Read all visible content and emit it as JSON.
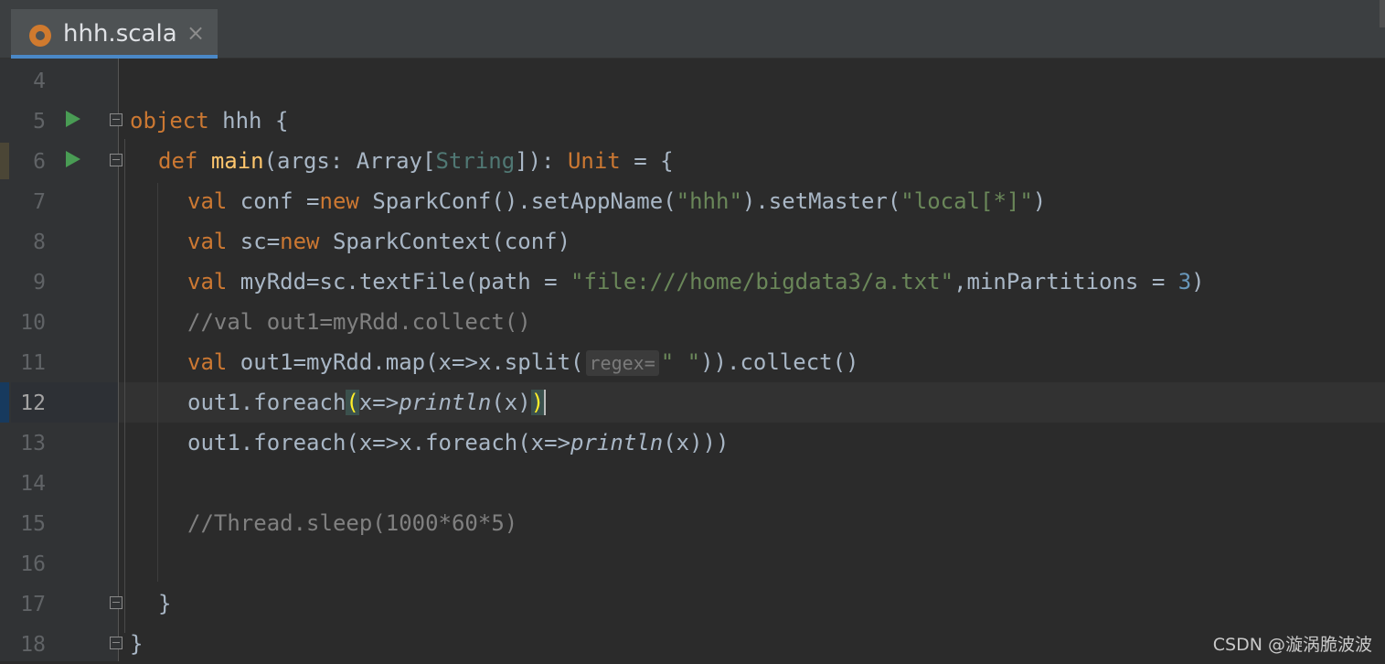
{
  "tab": {
    "label": "hhh.scala",
    "close": "×"
  },
  "lines": [
    {
      "num": "4",
      "code": ""
    },
    {
      "num": "5",
      "code": "object hhh {"
    },
    {
      "num": "6",
      "code": "def main(args: Array[String]): Unit = {"
    },
    {
      "num": "7",
      "code": "val conf =new SparkConf().setAppName(\"hhh\").setMaster(\"local[*]\")"
    },
    {
      "num": "8",
      "code": "val sc=new SparkContext(conf)"
    },
    {
      "num": "9",
      "code": "val myRdd=sc.textFile(path = \"file:///home/bigdata3/a.txt\",minPartitions = 3)"
    },
    {
      "num": "10",
      "code": "//val out1=myRdd.collect()"
    },
    {
      "num": "11",
      "code": "val out1=myRdd.map(x=>x.split(regex= \" \")).collect()"
    },
    {
      "num": "12",
      "code": "out1.foreach(x=>println(x))"
    },
    {
      "num": "13",
      "code": "out1.foreach(x=>x.foreach(x=>println(x)))"
    },
    {
      "num": "14",
      "code": ""
    },
    {
      "num": "15",
      "code": "//Thread.sleep(1000*60*5)"
    },
    {
      "num": "16",
      "code": ""
    },
    {
      "num": "17",
      "code": "}"
    },
    {
      "num": "18",
      "code": "}"
    }
  ],
  "hint": {
    "label": "regex="
  },
  "watermark": "CSDN @漩涡脆波波",
  "colors": {
    "background": "#2b2b2b",
    "keyword": "#cc7832",
    "function": "#ffc66d",
    "string": "#6a8759",
    "number": "#6897bb",
    "comment": "#808080",
    "run": "#499c54",
    "tab_underline": "#4a88c7"
  },
  "icons": {
    "tab": "scala-object-icon",
    "run": "run-gutter-icon",
    "fold": "fold-icon"
  }
}
